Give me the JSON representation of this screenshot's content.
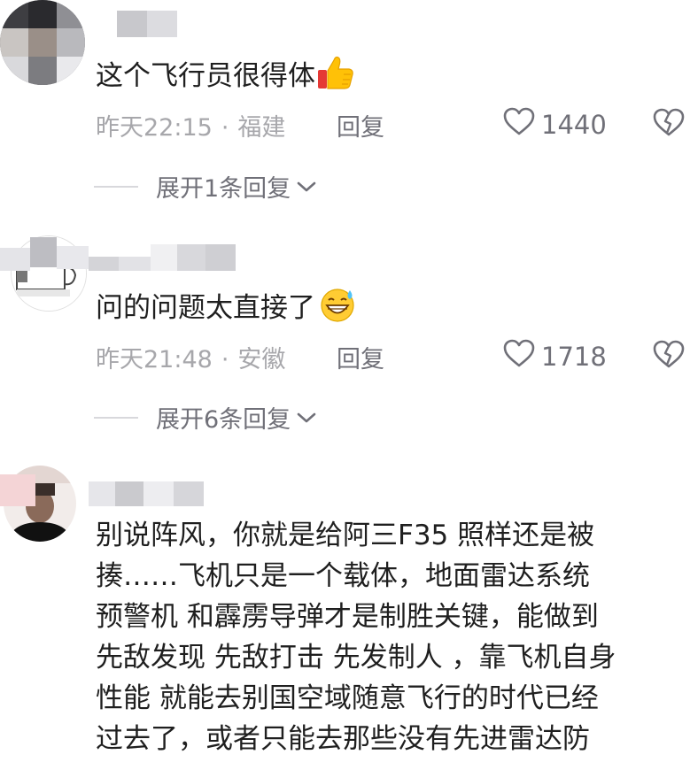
{
  "comments": [
    {
      "text": "这个飞行员很得体",
      "emoji": "thumbs-up",
      "time": "昨天22:15",
      "location": "福建",
      "reply_label": "回复",
      "likes": "1440",
      "expand_label": "展开1条回复"
    },
    {
      "text": "问的问题太直接了",
      "emoji": "sweat-grin-face",
      "time": "昨天21:48",
      "location": "安徽",
      "reply_label": "回复",
      "likes": "1718",
      "expand_label": "展开6条回复"
    },
    {
      "lines": [
        "别说阵风，你就是给阿三F35  照样还是被",
        "揍……飞机只是一个载体，地面雷达系统",
        "预警机 和霹雳导弹才是制胜关键，能做到",
        "先敌发现 先敌打击 先发制人 ，靠飞机自身",
        "性能 就能去别国空域随意飞行的时代已经",
        "过去了，或者只能去那些没有先进雷达防"
      ]
    }
  ],
  "separator": "·",
  "colors": {
    "meta_gray": "#a7a7ab",
    "action_gray": "#707078",
    "text": "#1f1f1f"
  }
}
